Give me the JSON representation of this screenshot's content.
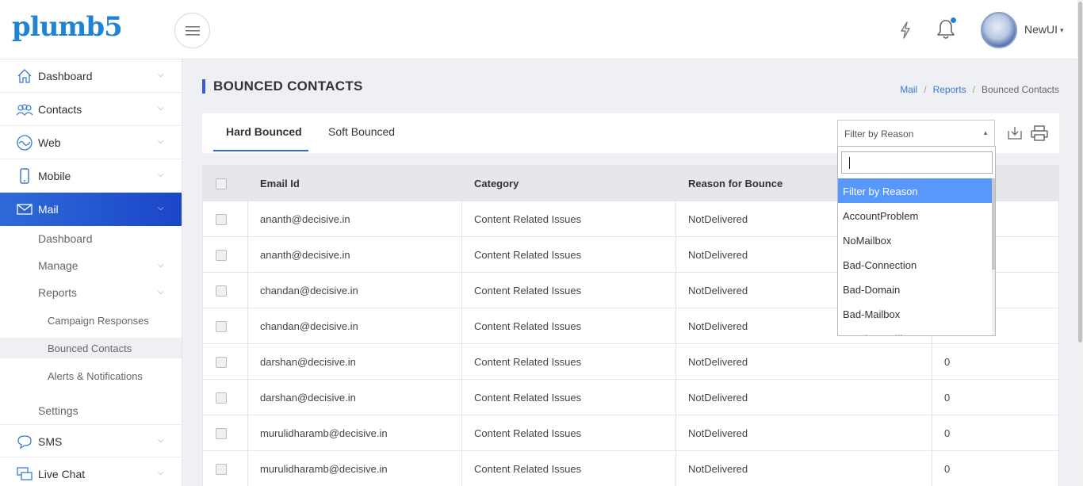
{
  "header": {
    "logo": "plumb5",
    "user_name": "NewUI"
  },
  "sidebar": {
    "items": [
      {
        "label": "Dashboard"
      },
      {
        "label": "Contacts"
      },
      {
        "label": "Web"
      },
      {
        "label": "Mobile"
      },
      {
        "label": "Mail"
      },
      {
        "label": "SMS"
      },
      {
        "label": "Live Chat"
      }
    ],
    "mail_sub": [
      {
        "label": "Dashboard"
      },
      {
        "label": "Manage"
      },
      {
        "label": "Reports"
      },
      {
        "label": "Settings"
      }
    ],
    "reports_sub": [
      {
        "label": "Campaign Responses"
      },
      {
        "label": "Bounced Contacts"
      },
      {
        "label": "Alerts & Notifications"
      }
    ]
  },
  "page": {
    "title": "BOUNCED CONTACTS",
    "breadcrumb": [
      "Mail",
      "Reports",
      "Bounced Contacts"
    ]
  },
  "tabs": [
    "Hard Bounced",
    "Soft Bounced"
  ],
  "filter": {
    "selected": "Filter by Reason",
    "options": [
      "Filter by Reason",
      "AccountProblem",
      "NoMailbox",
      "Bad-Connection",
      "Bad-Domain",
      "Bad-Mailbox",
      "Inactive Mailbox"
    ]
  },
  "table": {
    "headers": [
      "Email Id",
      "Category",
      "Reason for Bounce",
      ""
    ],
    "rows": [
      [
        "ananth@decisive.in",
        "Content Related Issues",
        "NotDelivered",
        ""
      ],
      [
        "ananth@decisive.in",
        "Content Related Issues",
        "NotDelivered",
        ""
      ],
      [
        "chandan@decisive.in",
        "Content Related Issues",
        "NotDelivered",
        ""
      ],
      [
        "chandan@decisive.in",
        "Content Related Issues",
        "NotDelivered",
        ""
      ],
      [
        "darshan@decisive.in",
        "Content Related Issues",
        "NotDelivered",
        "0"
      ],
      [
        "darshan@decisive.in",
        "Content Related Issues",
        "NotDelivered",
        "0"
      ],
      [
        "murulidharamb@decisive.in",
        "Content Related Issues",
        "NotDelivered",
        "0"
      ],
      [
        "murulidharamb@decisive.in",
        "Content Related Issues",
        "NotDelivered",
        "0"
      ]
    ]
  },
  "colors": {
    "brand": "#1f84d8",
    "active_nav": "#2e6bd9",
    "highlight": "#5897fb"
  }
}
